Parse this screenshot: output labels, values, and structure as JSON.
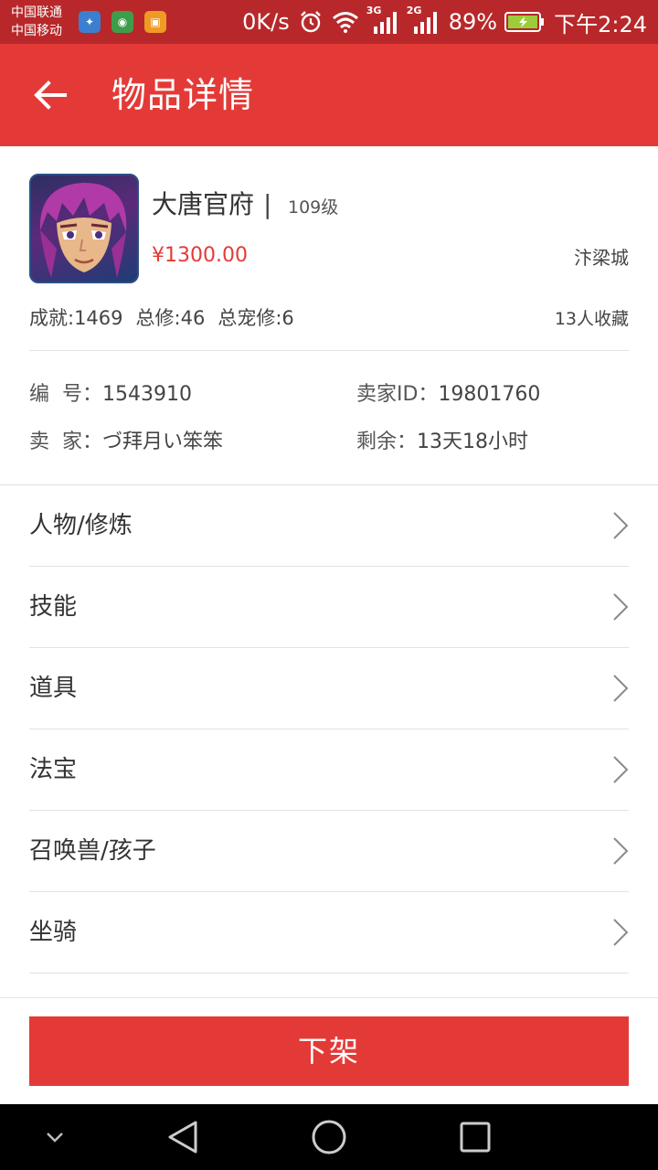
{
  "status_bar": {
    "carrier_1": "中国联通",
    "carrier_2": "中国移动",
    "app_icons": [
      "tencent-icon",
      "eye-icon",
      "shopping-bag-icon"
    ],
    "net_speed": "0K/s",
    "net_3g": "3G",
    "net_2g": "2G",
    "battery": "89%",
    "time": "下午2:24"
  },
  "header": {
    "title": "物品详情",
    "back_icon": "back-arrow-icon",
    "background": "#e43a37"
  },
  "item": {
    "name": "大唐官府",
    "separator": "|",
    "level": "109级",
    "price": "¥1300.00",
    "server": "汴梁城",
    "stats": [
      "成就:1469",
      "总修:46",
      "总宠修:6"
    ],
    "favorites": "13人收藏",
    "price_color": "#e43a37"
  },
  "details": {
    "id_label": "编  号：",
    "id_value": "1543910",
    "seller_id_label": "卖家ID：",
    "seller_id_value": "19801760",
    "seller_label": "卖  家：",
    "seller_value": "づ拜月い笨笨",
    "remaining_label": "剩余：",
    "remaining_value": "13天18小时"
  },
  "menu": [
    {
      "label": "人物/修炼"
    },
    {
      "label": "技能"
    },
    {
      "label": "道具"
    },
    {
      "label": "法宝"
    },
    {
      "label": "召唤兽/孩子"
    },
    {
      "label": "坐骑"
    }
  ],
  "action": {
    "delist_label": "下架"
  },
  "nav": {
    "icons": [
      "collapse-icon",
      "back-triangle-icon",
      "home-circle-icon",
      "recents-square-icon"
    ]
  }
}
